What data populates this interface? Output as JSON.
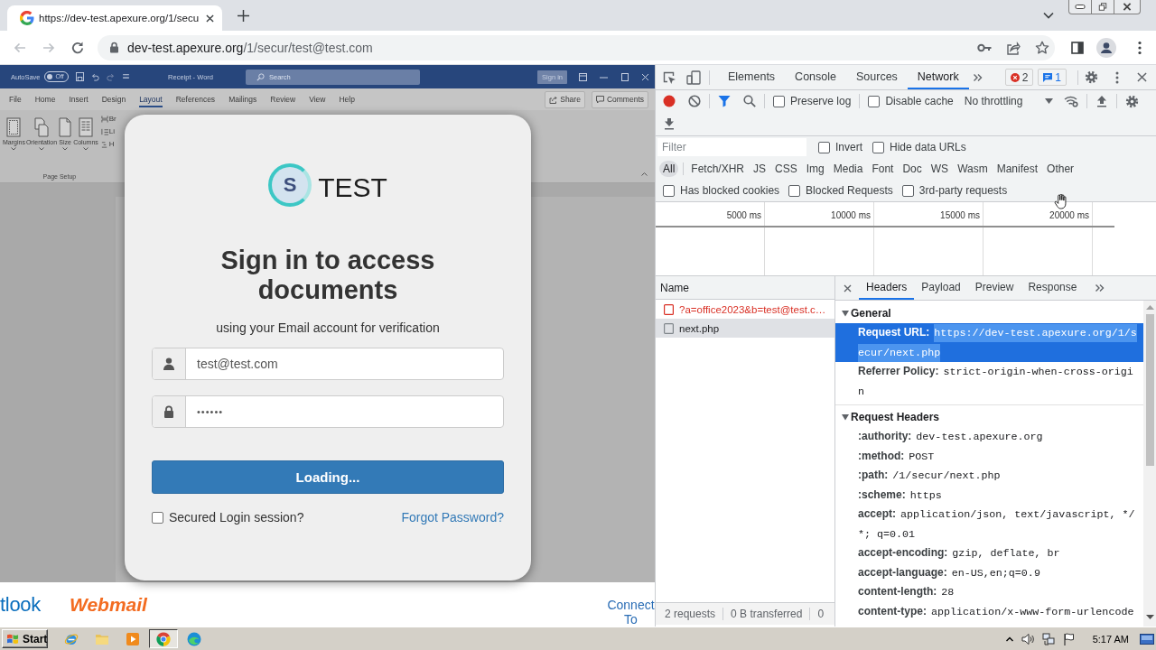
{
  "browser": {
    "tabs": [
      {
        "title": "https://dev-test.apexure.org/1/secu",
        "selected": true
      }
    ],
    "address": {
      "domain": "dev-test.apexure.org",
      "path": "/1/secur/test@test.com"
    }
  },
  "page": {
    "word_window": {
      "autosave": "AutoSave",
      "autosave_toggle": {
        "label": "Off",
        "on": false
      },
      "title": "Receipt - Word",
      "search_placeholder": "Search",
      "sign_in": "Sign in",
      "ribbon_tabs": [
        {
          "label": "File",
          "selected": false
        },
        {
          "label": "Home",
          "selected": false
        },
        {
          "label": "Insert",
          "selected": false
        },
        {
          "label": "Design",
          "selected": false
        },
        {
          "label": "Layout",
          "selected": true
        },
        {
          "label": "References",
          "selected": false
        },
        {
          "label": "Mailings",
          "selected": false
        },
        {
          "label": "Review",
          "selected": false
        },
        {
          "label": "View",
          "selected": false
        },
        {
          "label": "Help",
          "selected": false
        }
      ],
      "share": "Share",
      "comments": "Comments",
      "ribbon_buttons": [
        {
          "label": "Margins",
          "kind": "margins"
        },
        {
          "label": "Orientation",
          "kind": "orientation"
        },
        {
          "label": "Size",
          "kind": "size"
        },
        {
          "label": "Columns",
          "kind": "columns"
        }
      ],
      "ribbon_small_items": [
        {
          "label": "Br",
          "kind": "breaks"
        },
        {
          "label": "Li",
          "kind": "lines"
        },
        {
          "label": "H",
          "kind": "hyphens"
        }
      ],
      "group_label": "Page Setup"
    },
    "login": {
      "logo_mark": "S",
      "logo_text": "TEST",
      "heading": "Sign in to access documents",
      "subtitle": "using your Email account for verification",
      "email": {
        "value": "test@test.com"
      },
      "password": {
        "value": "••••••"
      },
      "submit": "Loading...",
      "remember": {
        "label": "Secured Login session?",
        "checked": false
      },
      "forgot_link": "Forgot Password?"
    },
    "footer": {
      "outlook_logo": "tlook",
      "webmail_logo": "Webmail",
      "connect_link": "Connect To"
    }
  },
  "devtools": {
    "tabs": [
      {
        "label": "Elements",
        "selected": false
      },
      {
        "label": "Console",
        "selected": false
      },
      {
        "label": "Sources",
        "selected": false
      },
      {
        "label": "Network",
        "selected": true
      }
    ],
    "errors": "2",
    "messages": "1",
    "toolbar": {
      "recording": true,
      "preserve_log": {
        "label": "Preserve log",
        "checked": false
      },
      "disable_cache": {
        "label": "Disable cache",
        "checked": false
      },
      "throttling": "No throttling"
    },
    "filter": {
      "placeholder": "Filter",
      "options": [
        {
          "label": "Invert",
          "checked": false
        },
        {
          "label": "Hide data URLs",
          "checked": false
        }
      ]
    },
    "type_filters": [
      {
        "label": "All",
        "selected": true
      },
      {
        "label": "Fetch/XHR",
        "selected": false
      },
      {
        "label": "JS",
        "selected": false
      },
      {
        "label": "CSS",
        "selected": false
      },
      {
        "label": "Img",
        "selected": false
      },
      {
        "label": "Media",
        "selected": false
      },
      {
        "label": "Font",
        "selected": false
      },
      {
        "label": "Doc",
        "selected": false
      },
      {
        "label": "WS",
        "selected": false
      },
      {
        "label": "Wasm",
        "selected": false
      },
      {
        "label": "Manifest",
        "selected": false
      },
      {
        "label": "Other",
        "selected": false
      }
    ],
    "extra_filters": [
      {
        "label": "Has blocked cookies",
        "checked": false
      },
      {
        "label": "Blocked Requests",
        "checked": false
      },
      {
        "label": "3rd-party requests",
        "checked": false
      }
    ],
    "overview": {
      "ticks": [
        "5000 ms",
        "10000 ms",
        "15000 ms",
        "20000 ms"
      ]
    },
    "requests": {
      "column": "Name",
      "rows": [
        {
          "name": "?a=office2023&b=test@test.c…",
          "failed": true,
          "selected": false
        },
        {
          "name": "next.php",
          "failed": false,
          "selected": true
        }
      ],
      "summary": [
        "2 requests",
        "0 B transferred",
        "0"
      ]
    },
    "details": {
      "tabs": [
        {
          "label": "Headers",
          "selected": true
        },
        {
          "label": "Payload",
          "selected": false
        },
        {
          "label": "Preview",
          "selected": false
        },
        {
          "label": "Response",
          "selected": false
        }
      ],
      "sections": [
        {
          "title": "General",
          "expanded": true,
          "rows": [
            {
              "name": "Request URL:",
              "value": "https://dev-test.apexure.org/1/secur/next.php",
              "highlighted": true
            },
            {
              "name": "Referrer Policy:",
              "value": "strict-origin-when-cross-origin",
              "highlighted": false
            }
          ]
        },
        {
          "title": "Request Headers",
          "expanded": true,
          "rows": [
            {
              "name": ":authority:",
              "value": "dev-test.apexure.org",
              "highlighted": false
            },
            {
              "name": ":method:",
              "value": "POST",
              "highlighted": false
            },
            {
              "name": ":path:",
              "value": "/1/secur/next.php",
              "highlighted": false
            },
            {
              "name": ":scheme:",
              "value": "https",
              "highlighted": false
            },
            {
              "name": "accept:",
              "value": "application/json, text/javascript, */*; q=0.01",
              "highlighted": false
            },
            {
              "name": "accept-encoding:",
              "value": "gzip, deflate, br",
              "highlighted": false
            },
            {
              "name": "accept-language:",
              "value": "en-US,en;q=0.9",
              "highlighted": false
            },
            {
              "name": "content-length:",
              "value": "28",
              "highlighted": false
            },
            {
              "name": "content-type:",
              "value": "application/x-www-form-urlencode",
              "highlighted": false
            }
          ]
        }
      ]
    }
  },
  "taskbar": {
    "start": "Start",
    "apps": [
      {
        "kind": "ie",
        "active": false
      },
      {
        "kind": "folder",
        "active": false
      },
      {
        "kind": "media",
        "active": false
      },
      {
        "kind": "chrome",
        "active": true
      },
      {
        "kind": "edge",
        "active": false
      }
    ],
    "clock": "5:17 AM"
  }
}
